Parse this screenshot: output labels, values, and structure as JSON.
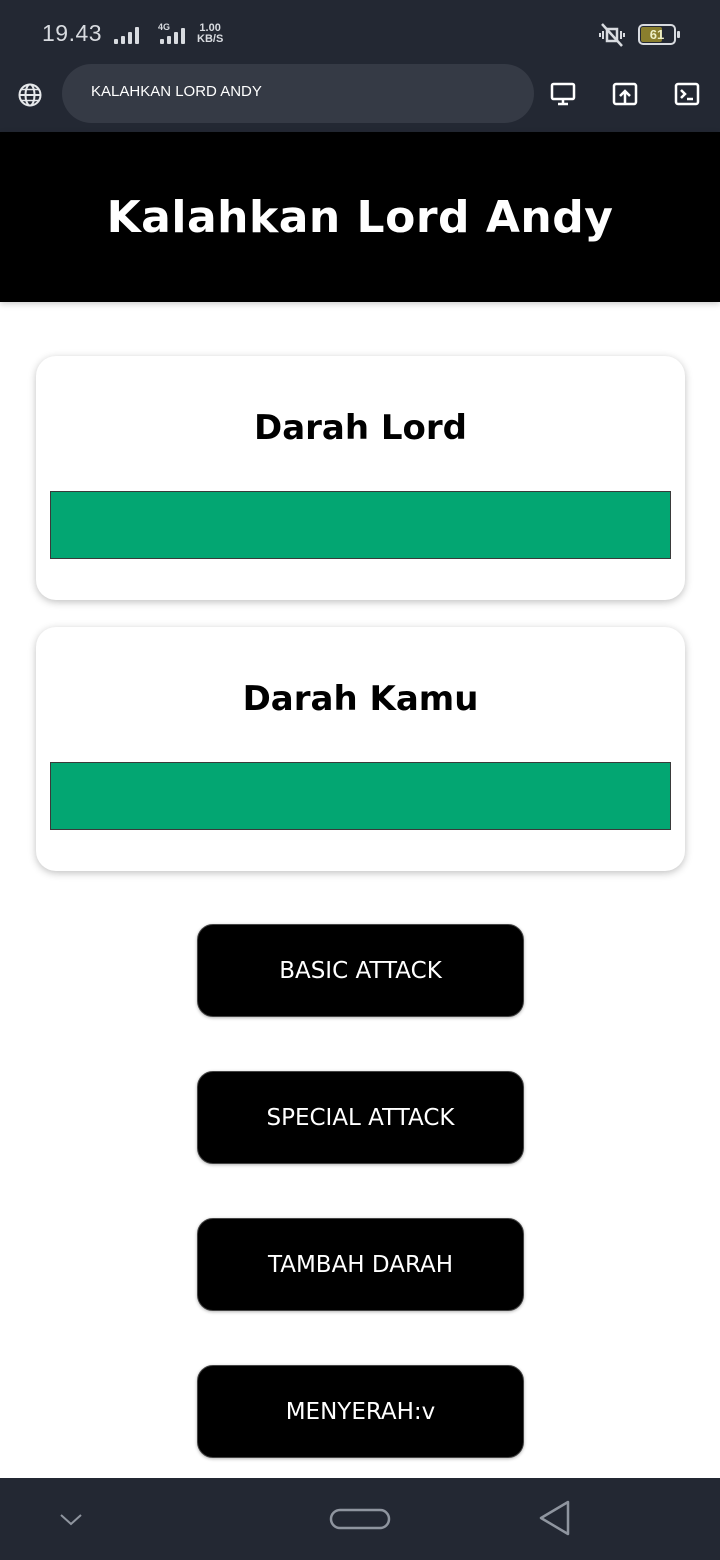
{
  "status_bar": {
    "time": "19.43",
    "network_type": "4G",
    "speed_value": "1.00",
    "speed_unit": "KB/S",
    "battery": "61"
  },
  "browser": {
    "url_text": "KALAHKAN LORD ANDY"
  },
  "page": {
    "title": "Kalahkan Lord Andy"
  },
  "lord_card": {
    "title": "Darah Lord",
    "health_fraction": 1.0,
    "color": "#03a672"
  },
  "kamu_card": {
    "title": "Darah Kamu",
    "health_fraction": 1.0,
    "color": "#03a672"
  },
  "actions": {
    "basic_attack": "BASIC ATTACK",
    "special_attack": "SPECIAL ATTACK",
    "heal": "TAMBAH DARAH",
    "surrender": "MENYERAH:v"
  }
}
